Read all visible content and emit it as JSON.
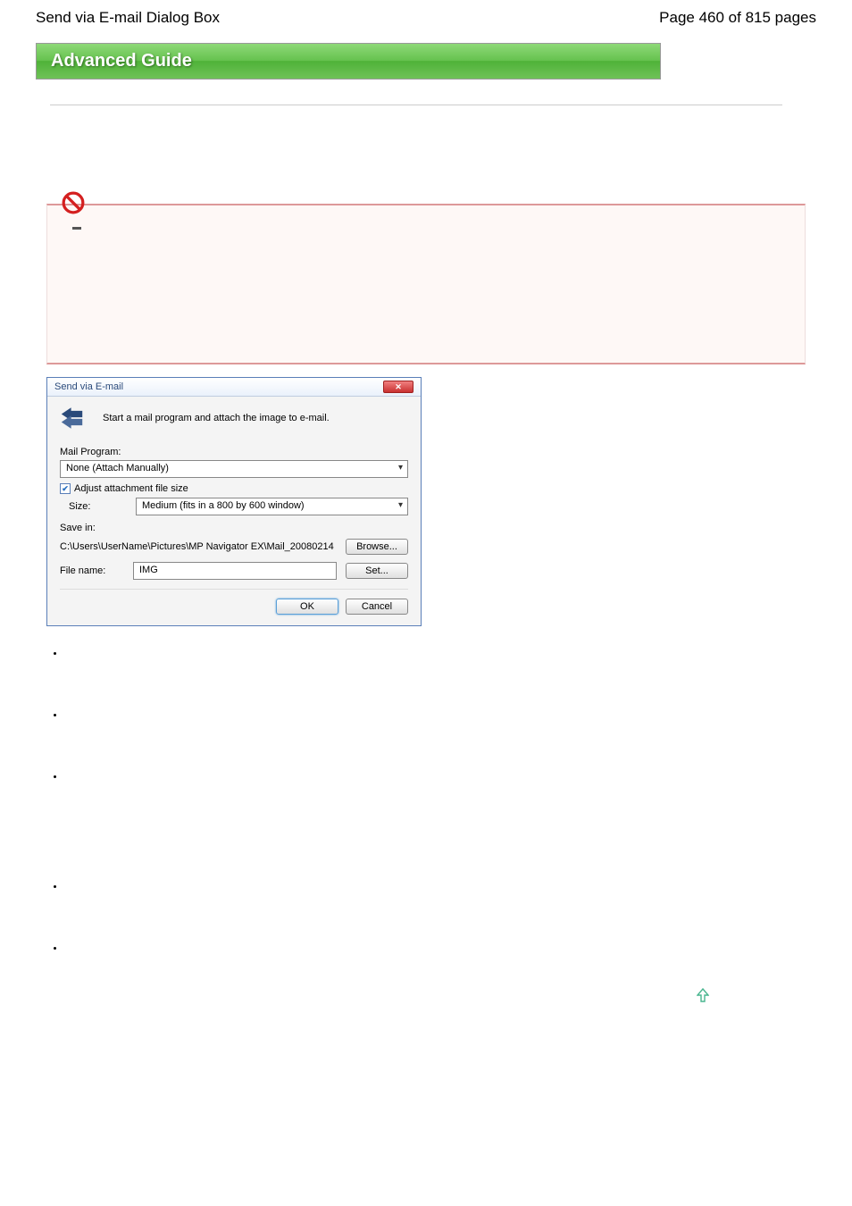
{
  "header": {
    "title_left": "Send via E-mail Dialog Box",
    "title_right": "Page 460 of 815 pages"
  },
  "banner": {
    "title": "Advanced Guide"
  },
  "dialog": {
    "title": "Send via E-mail",
    "description": "Start a mail program and attach the image to e-mail.",
    "mail_program_label": "Mail Program:",
    "mail_program_value": "None (Attach Manually)",
    "adjust_label": "Adjust attachment file size",
    "adjust_checked": true,
    "size_label": "Size:",
    "size_value": "Medium (fits in a 800 by 600 window)",
    "save_in_label": "Save in:",
    "save_in_path": "C:\\Users\\UserName\\Pictures\\MP Navigator EX\\Mail_20080214",
    "browse_label": "Browse...",
    "file_name_label": "File name:",
    "file_name_value": "IMG",
    "set_label": "Set...",
    "ok_label": "OK",
    "cancel_label": "Cancel"
  }
}
